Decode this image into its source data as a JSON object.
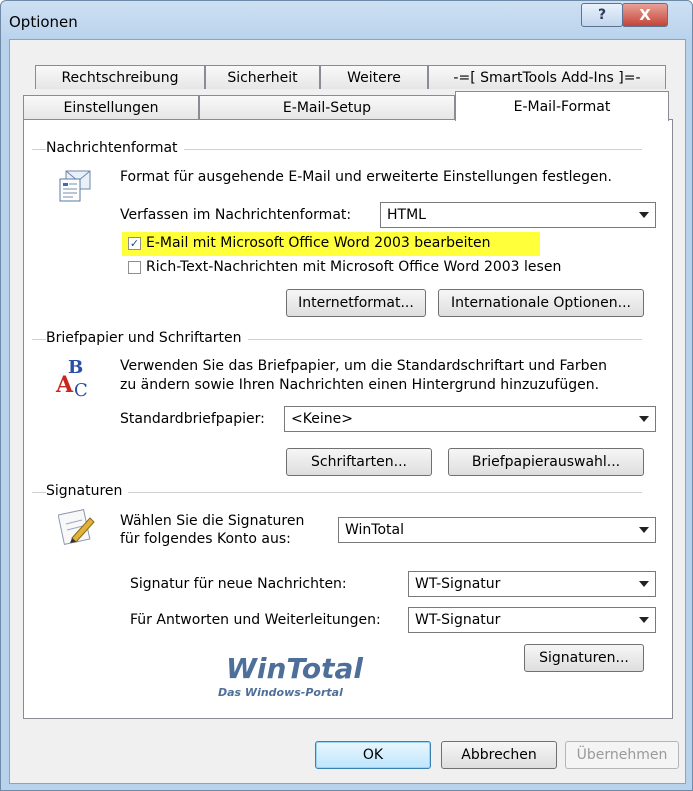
{
  "window": {
    "title": "Optionen",
    "help_glyph": "?",
    "close_glyph": "X"
  },
  "tabs_row1": [
    "Rechtschreibung",
    "Sicherheit",
    "Weitere",
    "-=[ SmartTools Add-Ins ]=-"
  ],
  "tabs_row2": [
    "Einstellungen",
    "E-Mail-Setup",
    "E-Mail-Format"
  ],
  "message_format": {
    "section_title": "Nachrichtenformat",
    "description": "Format für ausgehende E-Mail und erweiterte Einstellungen festlegen.",
    "compose_label": "Verfassen im Nachrichtenformat:",
    "compose_value": "HTML",
    "word_edit_label": "E-Mail mit Microsoft Office Word 2003 bearbeiten",
    "word_edit_checked": true,
    "richtext_label": "Rich-Text-Nachrichten mit Microsoft Office Word 2003 lesen",
    "richtext_checked": false,
    "internet_format_button": "Internetformat...",
    "international_button": "Internationale Optionen...",
    "highlight_color": "#ffff3a",
    "check_glyph": "✓"
  },
  "stationery": {
    "section_title": "Briefpapier und Schriftarten",
    "description_line1": "Verwenden Sie das Briefpapier, um die Standardschriftart und Farben",
    "description_line2": "zu ändern sowie Ihren Nachrichten einen Hintergrund hinzuzufügen.",
    "default_label": "Standardbriefpapier:",
    "default_value": "<Keine>",
    "fonts_button": "Schriftarten...",
    "stationery_picker_button": "Briefpapierauswahl...",
    "icon_letter_b": "B",
    "icon_letter_a": "A",
    "icon_letter_c": "C"
  },
  "signatures": {
    "section_title": "Signaturen",
    "choose_label_line1": "Wählen Sie die Signaturen",
    "choose_label_line2": "für folgendes Konto aus:",
    "account_value": "WinTotal",
    "new_messages_label": "Signatur für neue Nachrichten:",
    "new_messages_value": "WT-Signatur",
    "replies_label": "Für Antworten und Weiterleitungen:",
    "replies_value": "WT-Signatur",
    "signatures_button": "Signaturen..."
  },
  "watermark": {
    "logo_text": "WinTotal",
    "tagline": "Das Windows-Portal"
  },
  "footer": {
    "ok": "OK",
    "cancel": "Abbrechen",
    "apply": "Übernehmen"
  }
}
